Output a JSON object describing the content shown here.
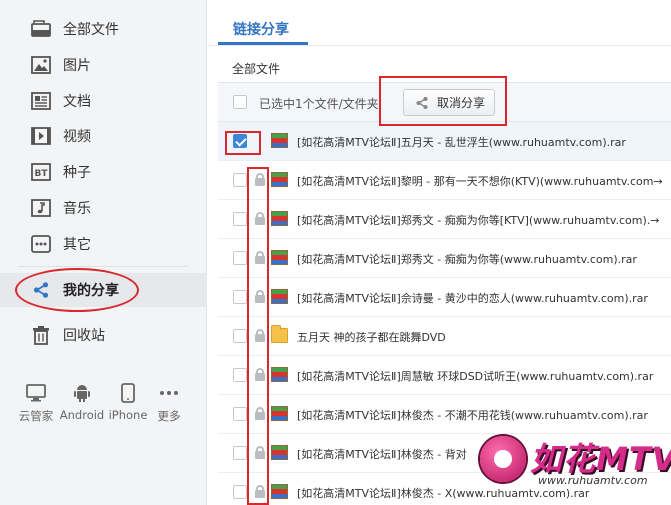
{
  "sidebar": {
    "items": [
      {
        "label": "全部文件",
        "icon": "all-files-icon"
      },
      {
        "label": "图片",
        "icon": "image-icon"
      },
      {
        "label": "文档",
        "icon": "document-icon"
      },
      {
        "label": "视频",
        "icon": "video-icon"
      },
      {
        "label": "种子",
        "icon": "bt-torrent-icon",
        "glyph": "BT"
      },
      {
        "label": "音乐",
        "icon": "music-icon"
      },
      {
        "label": "其它",
        "icon": "other-icon"
      },
      {
        "label": "我的分享",
        "icon": "share-icon"
      },
      {
        "label": "回收站",
        "icon": "trash-icon"
      }
    ],
    "devices": [
      {
        "label": "云管家",
        "icon": "desktop-icon"
      },
      {
        "label": "Android",
        "icon": "android-icon"
      },
      {
        "label": "iPhone",
        "icon": "iphone-icon"
      },
      {
        "label": "更多",
        "icon": "more-icon"
      }
    ]
  },
  "main": {
    "tab_title": "链接分享",
    "breadcrumb": "全部文件",
    "toolbar": {
      "selection_text": "已选中1个文件/文件夹",
      "cancel_share_label": "取消分享"
    },
    "files": [
      {
        "name": "[如花高清MTV论坛Ⅱ]五月天 - 乱世浮生(www.ruhuamtv.com).rar",
        "type": "rar",
        "selected": true,
        "locked": false
      },
      {
        "name": "[如花高清MTV论坛Ⅱ]黎明 - 那有一天不想你(KTV)(www.ruhuamtv.com→",
        "type": "rar",
        "selected": false,
        "locked": true
      },
      {
        "name": "[如花高清MTV论坛Ⅱ]郑秀文 - 痴痴为你等[KTV](www.ruhuamtv.com).→",
        "type": "rar",
        "selected": false,
        "locked": true
      },
      {
        "name": "[如花高清MTV论坛Ⅱ]郑秀文 - 痴痴为你等(www.ruhuamtv.com).rar",
        "type": "rar",
        "selected": false,
        "locked": true
      },
      {
        "name": "[如花高清MTV论坛Ⅱ]佘诗曼 - 黄沙中的恋人(www.ruhuamtv.com).rar",
        "type": "rar",
        "selected": false,
        "locked": true
      },
      {
        "name": "五月天 神的孩子都在跳舞DVD",
        "type": "folder",
        "selected": false,
        "locked": true
      },
      {
        "name": "[如花高清MTV论坛Ⅱ]周慧敏 环球DSD试听王(www.ruhuamtv.com).rar",
        "type": "rar",
        "selected": false,
        "locked": true
      },
      {
        "name": "[如花高清MTV论坛Ⅱ]林俊杰 - 不潮不用花钱(www.ruhuamtv.com).rar",
        "type": "rar",
        "selected": false,
        "locked": true
      },
      {
        "name": "[如花高清MTV论坛Ⅱ]林俊杰 - 背对",
        "type": "rar",
        "selected": false,
        "locked": true
      },
      {
        "name": "[如花高清MTV论坛Ⅱ]林俊杰 - X(www.ruhuamtv.com).rar",
        "type": "rar",
        "selected": false,
        "locked": true
      }
    ]
  },
  "watermark": {
    "title": "如花MTV",
    "url": "www.ruhuamtv.com"
  },
  "colors": {
    "accent": "#3476c4",
    "annotation_red": "#d9272e",
    "sidebar_bg": "#f3f4f6"
  }
}
